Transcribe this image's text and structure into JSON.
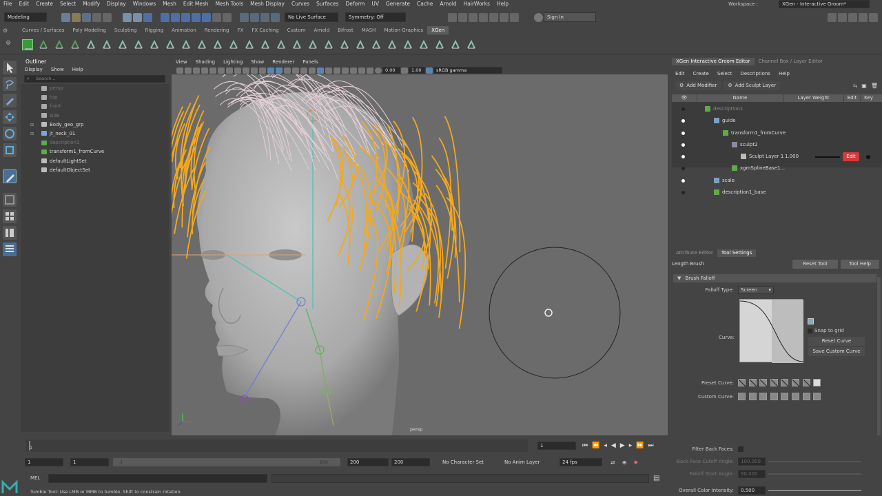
{
  "app": {
    "workspace_label": "Workspace :",
    "workspace_value": "XGen - Interactive Groom*"
  },
  "menubar": [
    "File",
    "Edit",
    "Create",
    "Select",
    "Modify",
    "Display",
    "Windows",
    "Mesh",
    "Edit Mesh",
    "Mesh Tools",
    "Mesh Display",
    "Curves",
    "Surfaces",
    "Deform",
    "UV",
    "Generate",
    "Cache",
    "Arnold",
    "HairWorks",
    "Help"
  ],
  "statusline": {
    "mode": "Modeling",
    "live_surface": "No Live Surface",
    "symmetry": "Symmetry: Off",
    "sign_in": "Sign In"
  },
  "shelf_tabs": [
    "Curves / Surfaces",
    "Poly Modeling",
    "Sculpting",
    "Rigging",
    "Animation",
    "Rendering",
    "FX",
    "FX Caching",
    "Custom",
    "Arnold",
    "Bifrost",
    "MASH",
    "Motion Graphics",
    "XGen"
  ],
  "shelf_active": "XGen",
  "outliner": {
    "title": "Outliner",
    "menu": [
      "Display",
      "Show",
      "Help"
    ],
    "search_placeholder": "Search...",
    "items": [
      {
        "label": "persp",
        "indent": 1,
        "dim": true,
        "color": "#aaaaaa"
      },
      {
        "label": "top",
        "indent": 1,
        "dim": true,
        "color": "#aaaaaa"
      },
      {
        "label": "front",
        "indent": 1,
        "dim": true,
        "color": "#aaaaaa"
      },
      {
        "label": "side",
        "indent": 1,
        "dim": true,
        "color": "#aaaaaa"
      },
      {
        "label": "Body_geo_grp",
        "indent": 1,
        "dim": false,
        "color": "#bbbbbb"
      },
      {
        "label": "jt_neck_01",
        "indent": 1,
        "dim": false,
        "color": "#7aa7d8"
      },
      {
        "label": "description1",
        "indent": 1,
        "dim": true,
        "color": "#5faa4a"
      },
      {
        "label": "transform1_fromCurve",
        "indent": 1,
        "dim": false,
        "color": "#5faa4a"
      },
      {
        "label": "defaultLightSet",
        "indent": 1,
        "dim": false,
        "color": "#bbbbbb"
      },
      {
        "label": "defaultObjectSet",
        "indent": 1,
        "dim": false,
        "color": "#bbbbbb"
      }
    ]
  },
  "viewport": {
    "menu": [
      "View",
      "Shading",
      "Lighting",
      "Show",
      "Renderer",
      "Panels"
    ],
    "value_a": "0.00",
    "value_b": "1.00",
    "colorspace": "sRGB gamma",
    "camera_label": "persp"
  },
  "xgen": {
    "tabs": [
      "XGen Interactive Groom Editor",
      "Channel Box / Layer Editor"
    ],
    "menu": [
      "Edit",
      "Create",
      "Select",
      "Descriptions",
      "Help"
    ],
    "add_modifier": "Add Modifier",
    "add_sculpt_layer": "Add Sculpt Layer",
    "columns": [
      "Name",
      "Layer Weight",
      "Edit",
      "Key"
    ],
    "rows": [
      {
        "label": "description1",
        "indent": 0,
        "dim": true,
        "eye": false
      },
      {
        "label": "guide",
        "indent": 1,
        "dim": false,
        "eye": true
      },
      {
        "label": "transform1_fromCurve",
        "indent": 2,
        "dim": false,
        "eye": true
      },
      {
        "label": "sculpt2",
        "indent": 3,
        "dim": false,
        "eye": true
      },
      {
        "label": "Sculpt Layer 1",
        "indent": 4,
        "dim": false,
        "eye": true,
        "weight": "1.000",
        "edit": "Edit"
      },
      {
        "label": "xgmSplineBase1...",
        "indent": 3,
        "dim": false,
        "eye": false
      },
      {
        "label": "scale",
        "indent": 1,
        "dim": false,
        "eye": true
      },
      {
        "label": "description1_base",
        "indent": 1,
        "dim": false,
        "eye": false
      }
    ]
  },
  "attr": {
    "tabs": [
      "Attribute Editor",
      "Tool Settings"
    ],
    "tool_name": "Length Brush",
    "reset_tool": "Reset Tool",
    "tool_help": "Tool Help",
    "section": "Brush Falloff",
    "falloff_type_label": "Falloff Type:",
    "falloff_type_value": "Screen",
    "curve_label": "Curve:",
    "snap_to_grid": "Snap to grid",
    "reset_curve": "Reset Curve",
    "save_custom_curve": "Save Custom Curve",
    "preset_curve_label": "Preset Curve:",
    "custom_curve_label": "Custom Curve:",
    "filter_back_faces": "Filter Back Faces:",
    "back_face_cutoff": "Back Face Cutoff Angle:",
    "back_face_cutoff_value": "100.000",
    "falloff_start": "Falloff Start Angle:",
    "falloff_start_value": "90.000",
    "overall_color": "Overall Color Intensity:",
    "overall_color_value": "0.500"
  },
  "timeline": {
    "ticks": [
      "1",
      "",
      "",
      "",
      "",
      "",
      "",
      "",
      "",
      "",
      "",
      "",
      "",
      "",
      "",
      "",
      "",
      "",
      "",
      "",
      "",
      "",
      "",
      "",
      "",
      ""
    ],
    "current_frame": "1",
    "start": "1",
    "start2": "1",
    "range_start": "1",
    "range_end": "200",
    "end": "200",
    "end2": "200",
    "no_char_set": "No Character Set",
    "no_anim_layer": "No Anim Layer",
    "fps": "24 fps"
  },
  "cmdline": {
    "label": "MEL"
  },
  "helpline": {
    "text": "Tumble Tool: Use LMB or MMB to tumble. Shift to constrain rotation."
  }
}
